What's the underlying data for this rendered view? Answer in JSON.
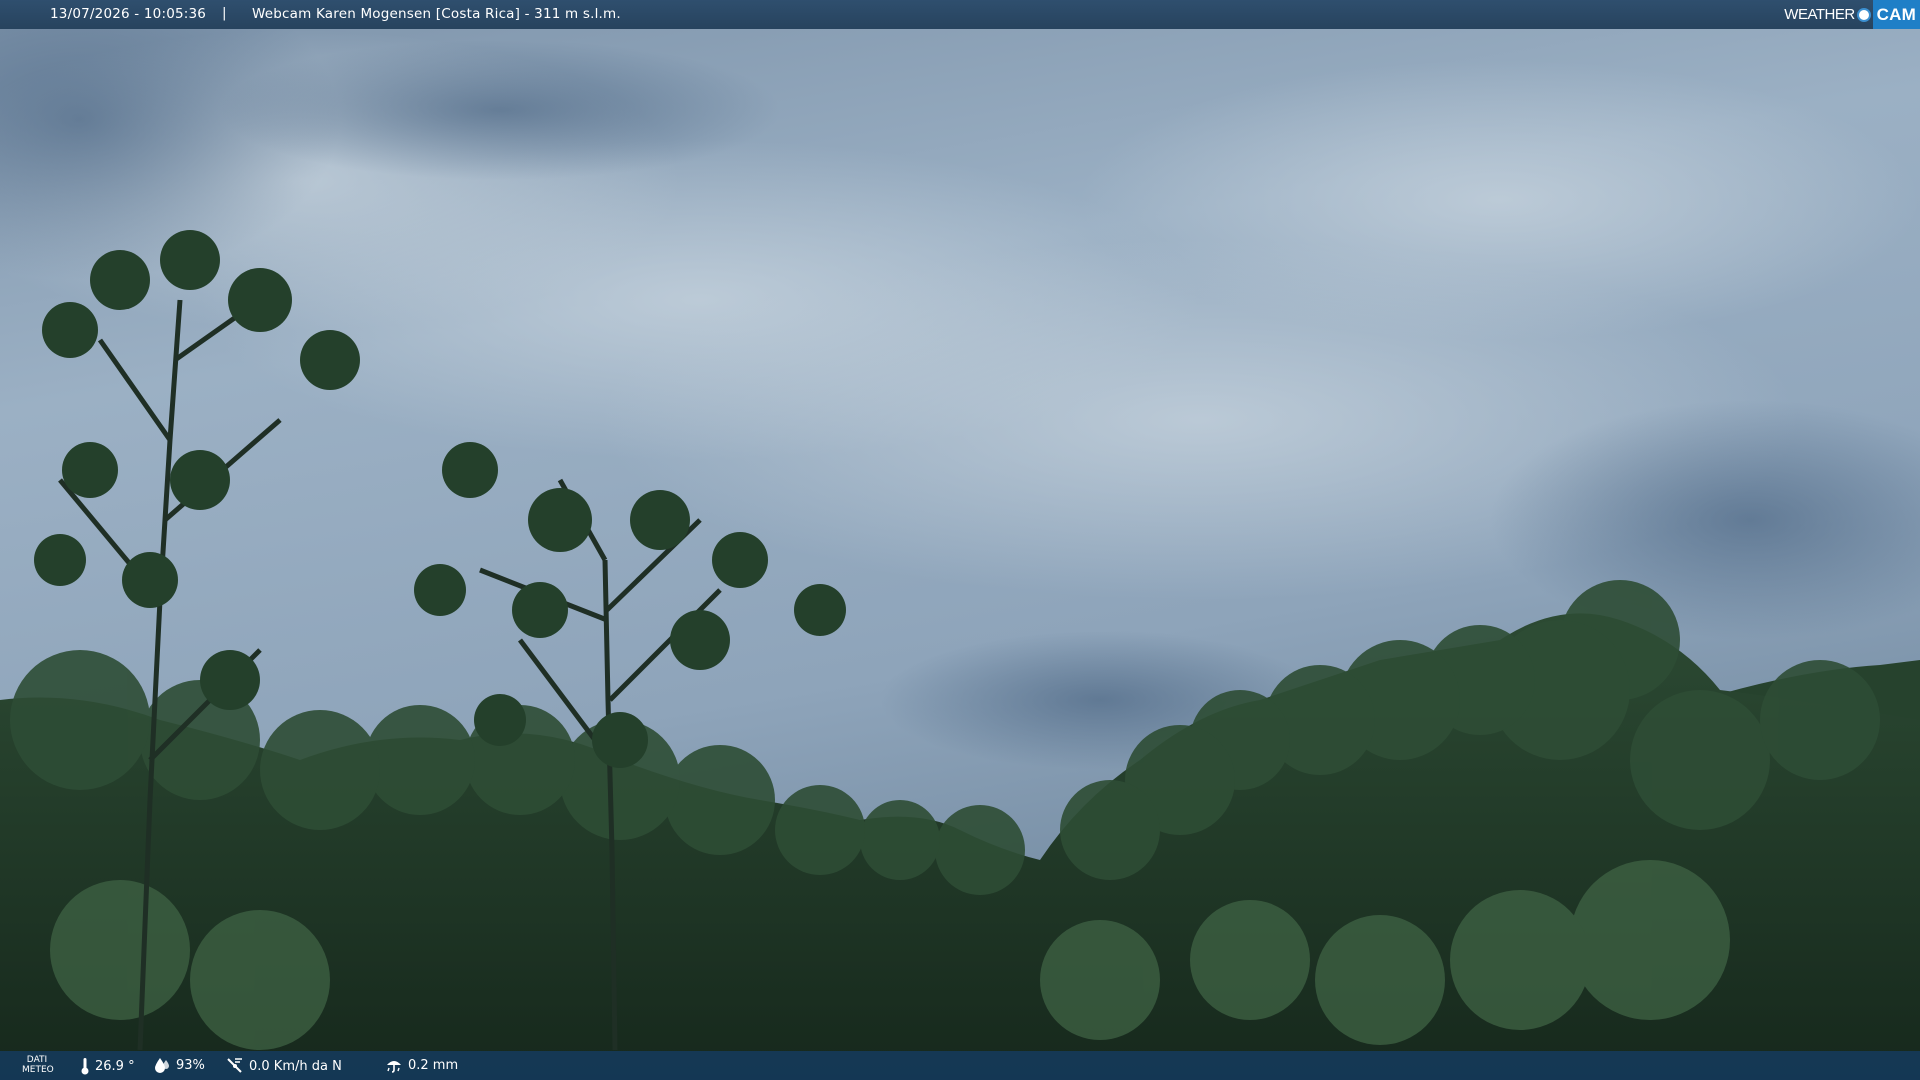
{
  "header": {
    "timestamp": "13/07/2026 - 10:05:36",
    "separator": "|",
    "title": "Webcam Karen Mogensen [Costa Rica] - 311 m s.l.m.",
    "logo_weather": "WEATHER",
    "logo_cam": "CAM"
  },
  "footer": {
    "dati_line1": "DATI",
    "dati_line2": "METEO",
    "temperature": "26.9 °",
    "humidity": "93%",
    "wind": "0.0 Km/h da N",
    "rain": "0.2 mm"
  },
  "icons": {
    "temperature": "thermometer-icon",
    "humidity": "humidity-drop-icon",
    "wind": "wind-icon",
    "rain": "rain-icon"
  },
  "colors": {
    "topbar": "#2f4f6e",
    "bottombar": "#143c64",
    "logo_accent": "#1f7fc7"
  }
}
